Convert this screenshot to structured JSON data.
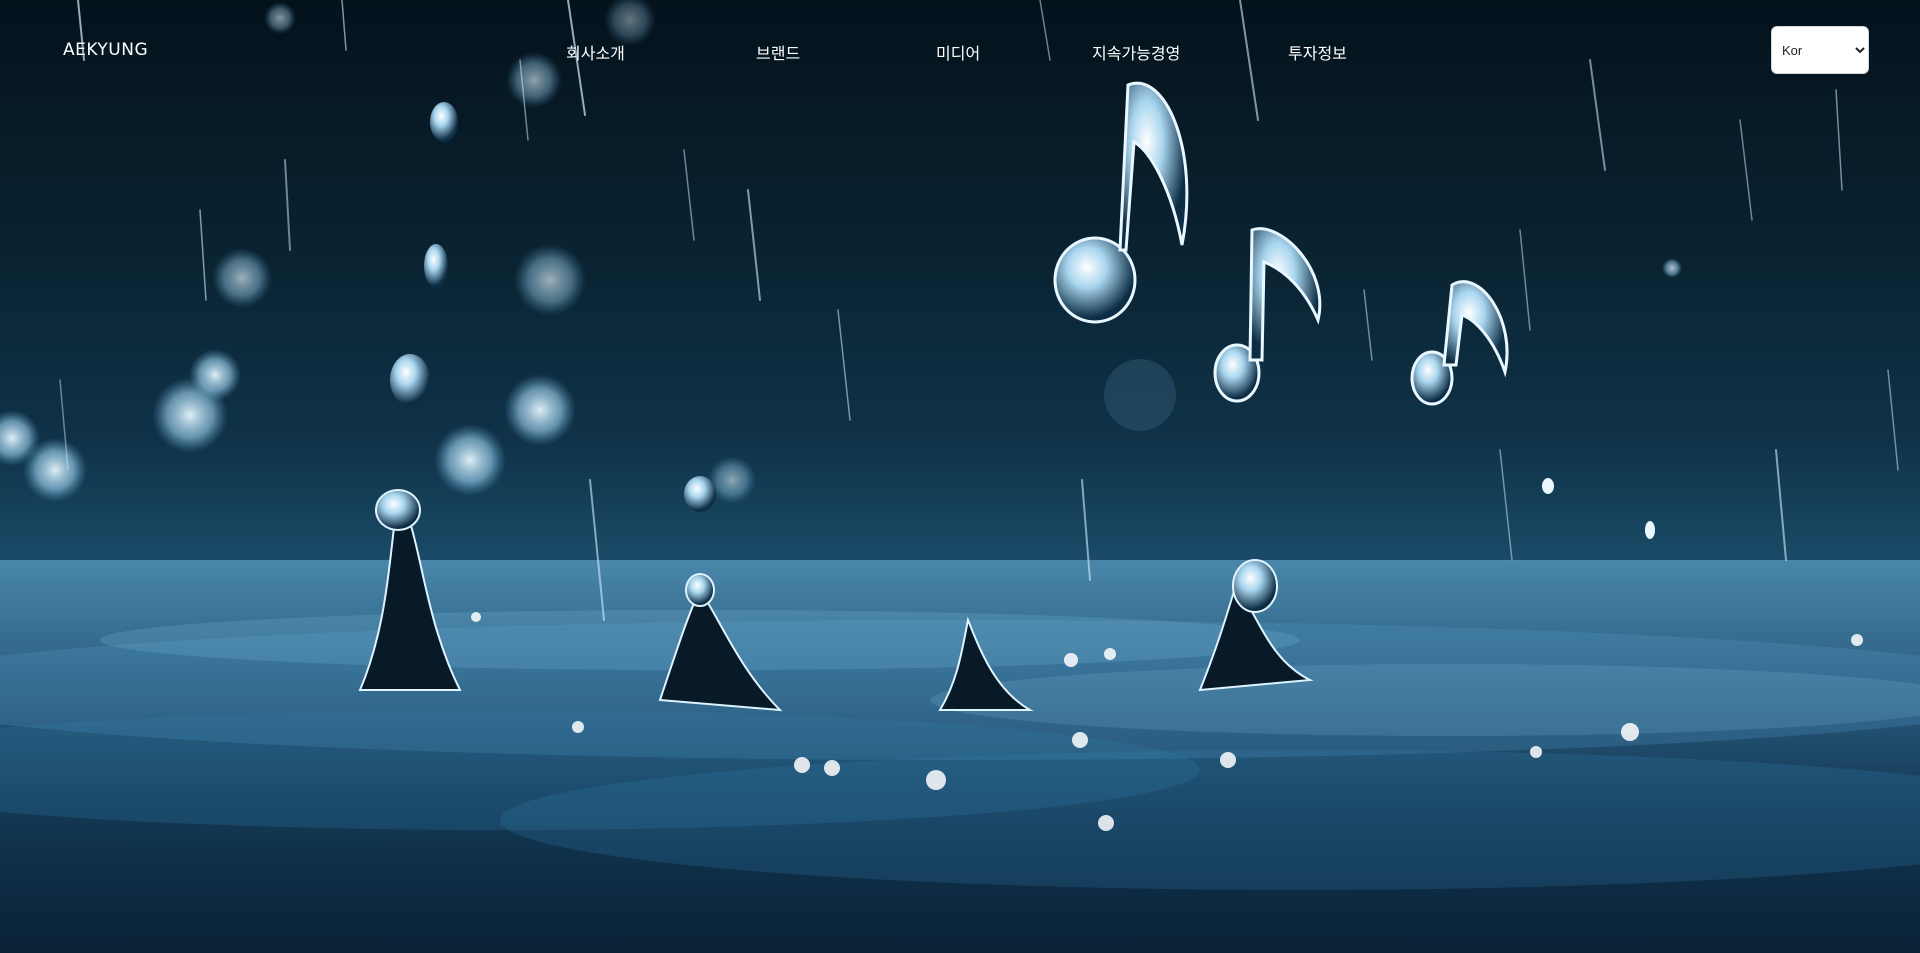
{
  "header": {
    "logo": "AEKYUNG",
    "nav": [
      {
        "label": "회사소개"
      },
      {
        "label": "브랜드"
      },
      {
        "label": "미디어"
      },
      {
        "label": "지속가능경영"
      },
      {
        "label": "투자정보"
      }
    ],
    "language": {
      "selected": "Kor",
      "options": [
        "Kor"
      ]
    }
  },
  "hero": {
    "image_icon": "rain-water-music-note-icon",
    "colors": {
      "water": "#1b4d6a",
      "night": "#04121c",
      "highlight": "#dff3ff"
    }
  }
}
